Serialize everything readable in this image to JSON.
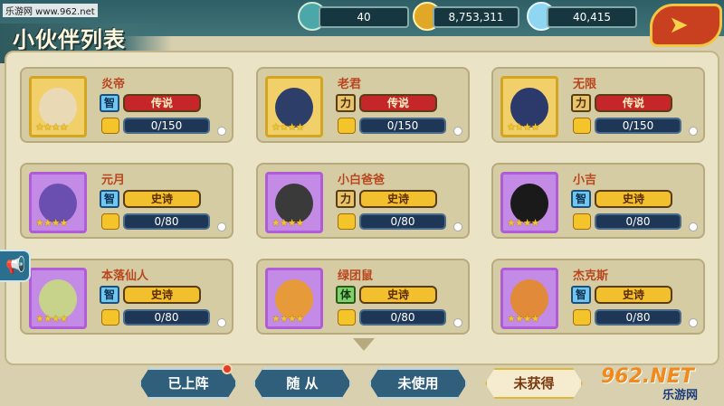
{
  "watermark_top": "乐游网 www.962.net",
  "page_title": "小伙伴列表",
  "resources": {
    "stamina": "40",
    "gold": "8,753,311",
    "diamonds": "40,415"
  },
  "tabs": [
    {
      "label": "已上阵",
      "active": false,
      "badge": true
    },
    {
      "label": "随 从",
      "active": false,
      "badge": false
    },
    {
      "label": "未使用",
      "active": false,
      "badge": false
    },
    {
      "label": "未获得",
      "active": true,
      "badge": false
    }
  ],
  "partners": [
    {
      "name": "炎帝",
      "attribute": "智",
      "rank": "传说",
      "rank_type": "legend",
      "progress": "0/150",
      "stars": 4,
      "frame": "gold"
    },
    {
      "name": "老君",
      "attribute": "力",
      "rank": "传说",
      "rank_type": "legend",
      "progress": "0/150",
      "stars": 4,
      "frame": "gold"
    },
    {
      "name": "无限",
      "attribute": "力",
      "rank": "传说",
      "rank_type": "legend",
      "progress": "0/150",
      "stars": 4,
      "frame": "gold"
    },
    {
      "name": "元月",
      "attribute": "智",
      "rank": "史诗",
      "rank_type": "epic",
      "progress": "0/80",
      "stars": 4,
      "frame": "purple"
    },
    {
      "name": "小白爸爸",
      "attribute": "力",
      "rank": "史诗",
      "rank_type": "epic",
      "progress": "0/80",
      "stars": 4,
      "frame": "purple"
    },
    {
      "name": "小吉",
      "attribute": "智",
      "rank": "史诗",
      "rank_type": "epic",
      "progress": "0/80",
      "stars": 4,
      "frame": "purple"
    },
    {
      "name": "本落仙人",
      "attribute": "智",
      "rank": "史诗",
      "rank_type": "epic",
      "progress": "0/80",
      "stars": 4,
      "frame": "purple"
    },
    {
      "name": "绿团鼠",
      "attribute": "体",
      "rank": "史诗",
      "rank_type": "epic",
      "progress": "0/80",
      "stars": 4,
      "frame": "purple"
    },
    {
      "name": "杰克斯",
      "attribute": "智",
      "rank": "史诗",
      "rank_type": "epic",
      "progress": "0/80",
      "stars": 4,
      "frame": "purple"
    }
  ],
  "watermark_bottom": {
    "big": "962.NET",
    "small": "乐游网"
  },
  "colors": {
    "legend": "#c5262a",
    "epic": "#f2bf2e",
    "accent": "#3f7479"
  }
}
